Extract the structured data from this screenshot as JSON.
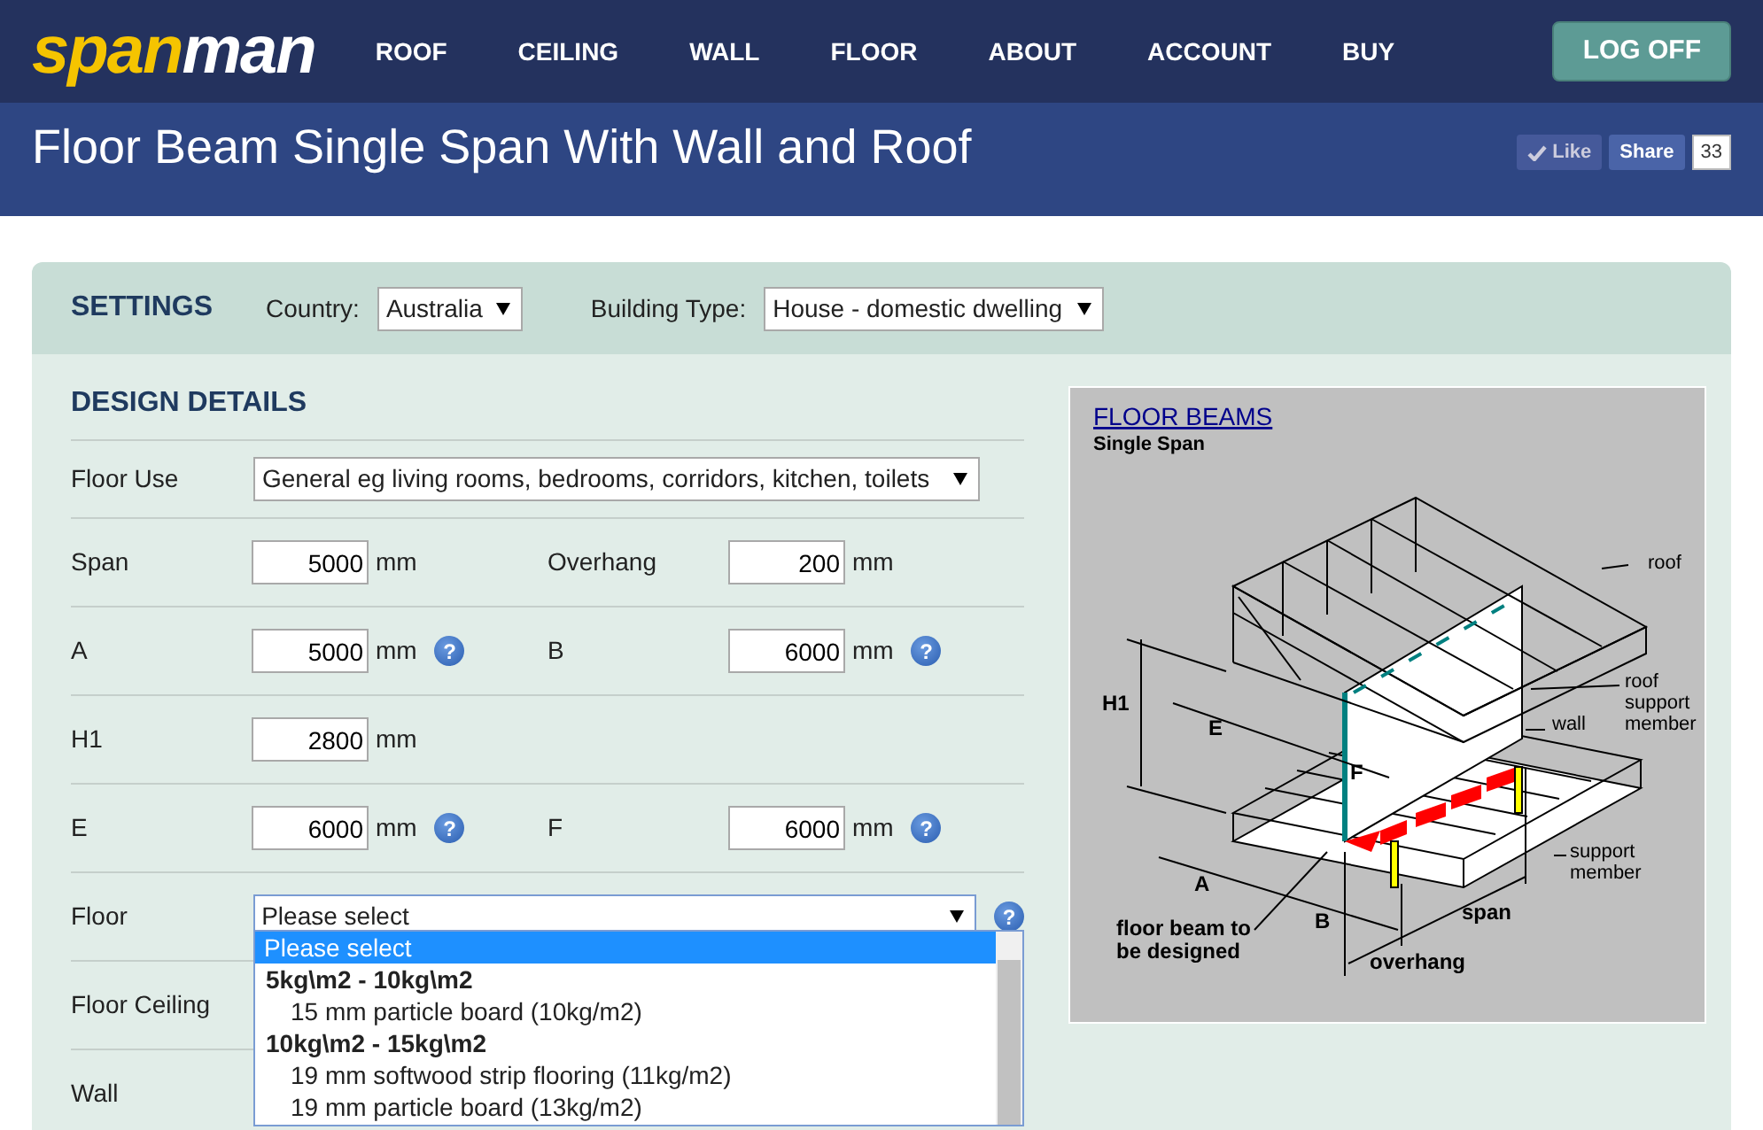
{
  "header": {
    "logo": {
      "first": "span",
      "second": "man"
    },
    "nav": [
      "ROOF",
      "CEILING",
      "WALL",
      "FLOOR",
      "ABOUT",
      "ACCOUNT",
      "BUY"
    ],
    "logoff": "LOG OFF"
  },
  "page_title": "Floor Beam Single Span With Wall and Roof",
  "social": {
    "like": "Like",
    "share": "Share",
    "count": "33"
  },
  "settings": {
    "heading": "SETTINGS",
    "country": {
      "label": "Country:",
      "value": "Australia"
    },
    "building_type": {
      "label": "Building Type:",
      "value": "House - domestic dwelling"
    }
  },
  "design": {
    "heading": "DESIGN DETAILS",
    "rows": [
      {
        "kind": "select",
        "label": "Floor Use",
        "value": "General eg living rooms, bedrooms, corridors, kitchen, toilets"
      },
      {
        "kind": "pair",
        "fields": [
          {
            "label": "Span",
            "value": "5000",
            "unit": "mm"
          },
          {
            "label": "Overhang",
            "value": "200",
            "unit": "mm"
          }
        ]
      },
      {
        "kind": "pair",
        "fields": [
          {
            "label": "A",
            "value": "5000",
            "unit": "mm",
            "help": "?"
          },
          {
            "label": "B",
            "value": "6000",
            "unit": "mm",
            "help": "?"
          }
        ]
      },
      {
        "kind": "pair",
        "fields": [
          {
            "label": "H1",
            "value": "2800",
            "unit": "mm"
          }
        ]
      },
      {
        "kind": "pair",
        "fields": [
          {
            "label": "E",
            "value": "6000",
            "unit": "mm",
            "help": "?"
          },
          {
            "label": "F",
            "value": "6000",
            "unit": "mm",
            "help": "?"
          }
        ]
      },
      {
        "kind": "select",
        "label": "Floor",
        "value": "Please select",
        "help": "?",
        "open": true
      },
      {
        "kind": "covered",
        "label": "Floor Ceiling"
      },
      {
        "kind": "covered",
        "label": "Wall"
      }
    ]
  },
  "floor_dropdown": [
    {
      "kind": "option",
      "text": "Please select",
      "selected": true
    },
    {
      "kind": "group",
      "text": "5kg\\m2 - 10kg\\m2"
    },
    {
      "kind": "option",
      "text": "15 mm particle board (10kg/m2)",
      "selected": false
    },
    {
      "kind": "group",
      "text": "10kg\\m2 - 15kg\\m2"
    },
    {
      "kind": "option",
      "text": "19 mm softwood strip flooring (11kg/m2)",
      "selected": false
    },
    {
      "kind": "option",
      "text": "19 mm particle board (13kg/m2)",
      "selected": false
    }
  ],
  "diagram": {
    "title": "FLOOR BEAMS",
    "subtitle": "Single Span",
    "labels": [
      {
        "kind": "callout",
        "text": "roof"
      },
      {
        "kind": "dimension",
        "text": "H1"
      },
      {
        "kind": "dimension",
        "text": "E"
      },
      {
        "kind": "callout",
        "text": "wall"
      },
      {
        "kind": "callout",
        "text": "roof support member"
      },
      {
        "kind": "dimension",
        "text": "F"
      },
      {
        "kind": "callout",
        "text": "support member"
      },
      {
        "kind": "dimension",
        "text": "A"
      },
      {
        "kind": "dimension",
        "text": "floor beam to be designed"
      },
      {
        "kind": "dimension",
        "text": "B"
      },
      {
        "kind": "dimension",
        "text": "span"
      },
      {
        "kind": "dimension",
        "text": "overhang"
      }
    ]
  }
}
